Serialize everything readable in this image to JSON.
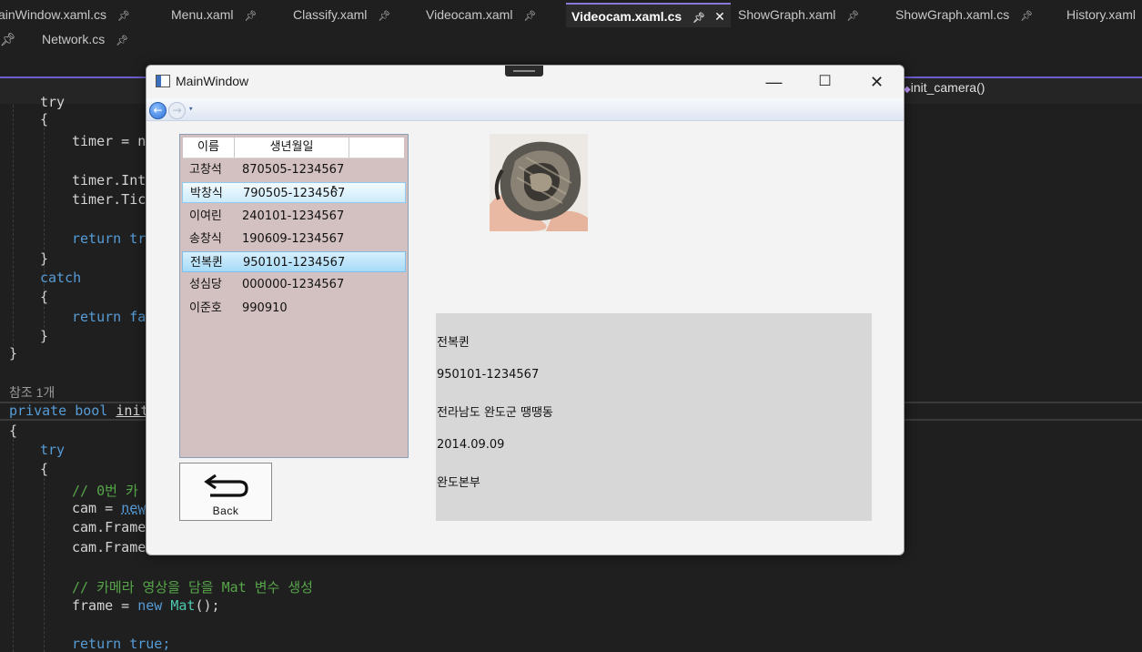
{
  "ide": {
    "tabs_row1": [
      {
        "label": "ainWindow.xaml.cs",
        "active": false
      },
      {
        "label": "Menu.xaml",
        "active": false
      },
      {
        "label": "Classify.xaml",
        "active": false
      },
      {
        "label": "Videocam.xaml",
        "active": false
      },
      {
        "label": "Videocam.xaml.cs",
        "active": true
      },
      {
        "label": "ShowGraph.xaml",
        "active": false
      },
      {
        "label": "ShowGraph.xaml.cs",
        "active": false
      },
      {
        "label": "History.xaml",
        "active": false
      }
    ],
    "tabs_row2": [
      {
        "label": "Network.cs"
      }
    ],
    "pin_glyph": "↕",
    "close_glyph": "✕",
    "nav_method": "init_camera()",
    "code": {
      "try1": "try",
      "brace_open": "{",
      "brace_close": "}",
      "timer_new": "timer = ne",
      "timer_inte": "timer.Inte",
      "timer_tic": "timer.Tic",
      "return_tr": "return tr",
      "catch": "catch",
      "return_fa": "return fa",
      "refs": "참조 1개",
      "private_bool": "private bool",
      "init": "init",
      "try2": "try",
      "comment_cam": "// 0번 카",
      "cam_new": "cam = ",
      "cam_new_kw": "new",
      "cam_frame1": "cam.Frame",
      "cam_frame2": "cam.Frame",
      "comment_mat": "// 카메라 영상을 담을 Mat 변수 생성",
      "frame_eq": "frame = ",
      "frame_new": "new",
      "frame_mat": "Mat",
      "frame_tail": "();",
      "return_true": "return",
      "true_kw": "true;"
    }
  },
  "window": {
    "title": "MainWindow",
    "minimize": "—",
    "maximize": "☐",
    "close": "✕",
    "nav_back_glyph": "←",
    "nav_fwd_glyph": "→",
    "nav_dropdown_glyph": "▾",
    "list": {
      "headers": [
        "이름",
        "생년월일"
      ],
      "rows": [
        {
          "name": "고창석",
          "birth": "870505-1234567"
        },
        {
          "name": "박창식",
          "birth": "790505-1234567"
        },
        {
          "name": "이여린",
          "birth": "240101-1234567"
        },
        {
          "name": "송창식",
          "birth": "190609-1234567"
        },
        {
          "name": "전복퀸",
          "birth": "950101-1234567"
        },
        {
          "name": "성심당",
          "birth": "000000-1234567"
        },
        {
          "name": "이준호",
          "birth": "990910"
        }
      ],
      "hover_index": 1,
      "selected_index": 4
    },
    "back_button": {
      "label": "Back"
    },
    "detail": {
      "name": "전복퀸",
      "id_number": "950101-1234567",
      "address": "전라남도 완도군 땡땡동",
      "date": "2014.09.09",
      "affiliation": "완도본부"
    },
    "colors": {
      "list_bg": "#d3c0c0",
      "detail_bg": "#d7d7d7",
      "selection": "#a6dbf7"
    }
  }
}
